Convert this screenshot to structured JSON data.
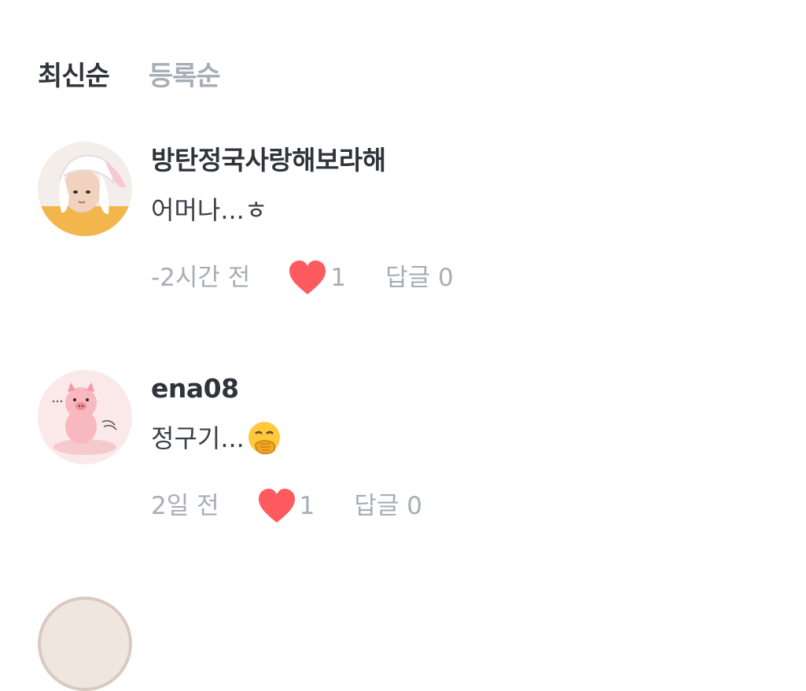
{
  "sort_tabs": [
    {
      "label": "최신순",
      "active": true
    },
    {
      "label": "등록순",
      "active": false
    }
  ],
  "comments": [
    {
      "author": "방탄정국사랑해보라해",
      "text": "어머나...ㅎ",
      "emoji": "",
      "time": "-2시간 전",
      "likes": "1",
      "reply": "답글 0",
      "avatar": "user-photo-avatar"
    },
    {
      "author": "ena08",
      "text": "정구기...",
      "emoji": "hand-over-mouth-emoji",
      "time": "2일 전",
      "likes": "1",
      "reply": "답글 0",
      "avatar": "pink-pig-avatar"
    }
  ],
  "colors": {
    "heart": "#ff5a5f",
    "meta_text": "#a7adb5",
    "active_tab": "#2f333a",
    "inactive_tab": "#a7adb5"
  }
}
